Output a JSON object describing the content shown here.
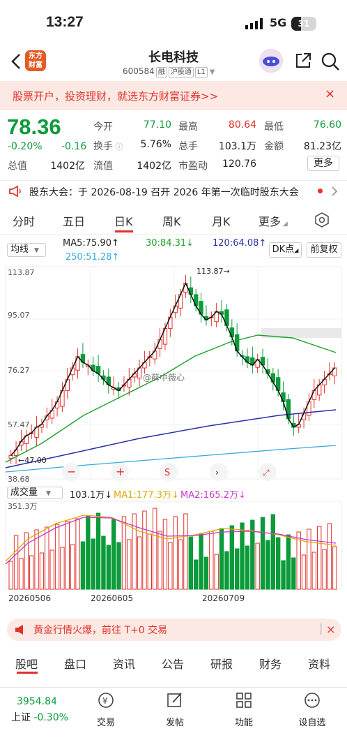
{
  "status": {
    "time": "13:27",
    "network": "5G",
    "battery": "31"
  },
  "header": {
    "title": "长电科技",
    "code": "600584",
    "tags": [
      "融",
      "沪股通",
      "L1"
    ],
    "logo_line1": "东方",
    "logo_line2": "财富"
  },
  "banner": {
    "text": "股票开户，投资理财，就选东方财富证券>>",
    "close": "×"
  },
  "quote": {
    "price": "78.36",
    "pct": "-0.20%",
    "change": "-0.16",
    "fields": [
      {
        "label": "今开",
        "value": "77.10",
        "color": "green"
      },
      {
        "label": "最高",
        "value": "80.64",
        "color": "red"
      },
      {
        "label": "最低",
        "value": "76.60",
        "color": "green"
      },
      {
        "label": "换手",
        "value": "5.76%",
        "color": "plain"
      },
      {
        "label": "总手",
        "value": "103.1万",
        "color": "plain"
      },
      {
        "label": "金额",
        "value": "81.23亿",
        "color": "plain"
      },
      {
        "label": "总值",
        "value": "1402亿",
        "color": "plain"
      },
      {
        "label": "流值",
        "value": "1402亿",
        "color": "plain"
      },
      {
        "label": "市盈动",
        "value": "120.76",
        "color": "plain"
      }
    ],
    "more": "更多"
  },
  "notice": {
    "text": "股东大会：于 2026-08-19 召开 2026 年第一次临时股东大会"
  },
  "tabs": [
    "分时",
    "五日",
    "日K",
    "周K",
    "月K",
    "更多"
  ],
  "ma": {
    "select": "均线",
    "ma5": "MA5:75.90↑",
    "ma30": "30:84.31↓",
    "ma120": "120:64.08↑",
    "ma250": "250:51.28↑",
    "dk": "DK点",
    "fq": "前复权"
  },
  "axis": {
    "y1": "113.87",
    "y2": "95.07",
    "y3": "76.27",
    "y4": "57.47",
    "y5": "38.68",
    "high_label": "113.87→",
    "low_label": "←47.00"
  },
  "watermark": "@薛中薇心",
  "volume": {
    "select": "成交量",
    "vol": "103.1万↓",
    "ma1": "MA1:177.3万↓",
    "ma2": "MA2:165.2万↓",
    "max": "351.3万"
  },
  "dates": [
    "20260506",
    "20260605",
    "20260709"
  ],
  "gold": {
    "text": "黄金行情火爆，前往 T+0 交易"
  },
  "subtabs": [
    "股吧",
    "盘口",
    "资讯",
    "公告",
    "研报",
    "财务",
    "资料"
  ],
  "bottom": {
    "index_value": "3954.84",
    "index_name": "上证",
    "index_pct": "-0.30%",
    "nav": [
      "交易",
      "发帖",
      "功能",
      "设自选"
    ]
  },
  "chart_data": {
    "type": "candlestick",
    "ylim": [
      38.68,
      113.87
    ],
    "high": 113.87,
    "low": 47.0,
    "close_series": [
      47,
      49,
      52,
      54,
      55,
      57,
      58,
      61,
      63,
      66,
      70,
      74,
      78,
      82,
      80,
      79,
      77,
      76,
      74,
      72,
      71,
      70,
      72,
      74,
      76,
      78,
      80,
      82,
      84,
      88,
      92,
      96,
      100,
      104,
      108,
      104,
      100,
      97,
      95,
      96,
      98,
      97,
      93,
      89,
      84,
      82,
      80,
      79,
      81,
      79,
      76,
      73,
      70,
      66,
      60,
      57,
      58,
      62,
      66,
      70,
      72,
      74,
      76,
      78
    ]
  },
  "colors": {
    "accent": "#e0312a",
    "down": "#0b9b3a",
    "banner": "#fde9e4"
  }
}
